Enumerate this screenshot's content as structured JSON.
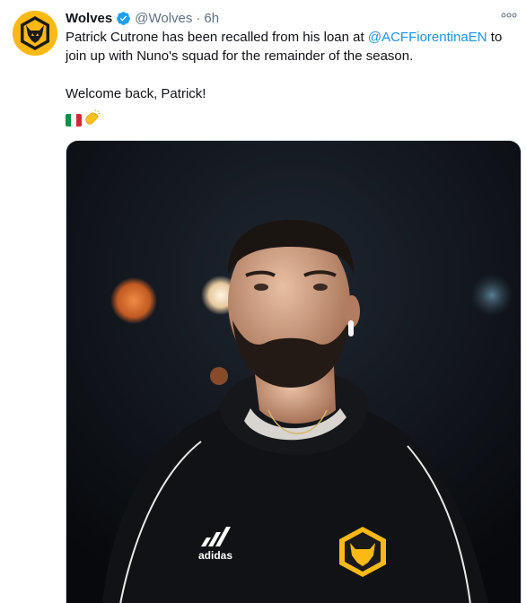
{
  "tweet": {
    "display_name": "Wolves",
    "handle": "@Wolves",
    "separator": "·",
    "time": "6h",
    "text_line1_before": "Patrick Cutrone has been recalled from his loan at ",
    "mention": "@ACFFiorentinaEN",
    "text_line1_after": " to",
    "text_line2": "join up with Nuno's squad for the remainder of the season.",
    "text_para2": "Welcome back, Patrick!",
    "emoji": [
      "italy-flag",
      "clapping-hands"
    ],
    "verified": true,
    "image_text": "adidas"
  },
  "colors": {
    "link": "#1b95e0",
    "secondary": "#5b7083",
    "wolves_gold": "#fdb913",
    "verified_blue": "#1da1f2"
  },
  "icons": {
    "avatar": "wolves-crest-icon",
    "verified": "verified-badge-icon",
    "more": "more-options-icon"
  }
}
